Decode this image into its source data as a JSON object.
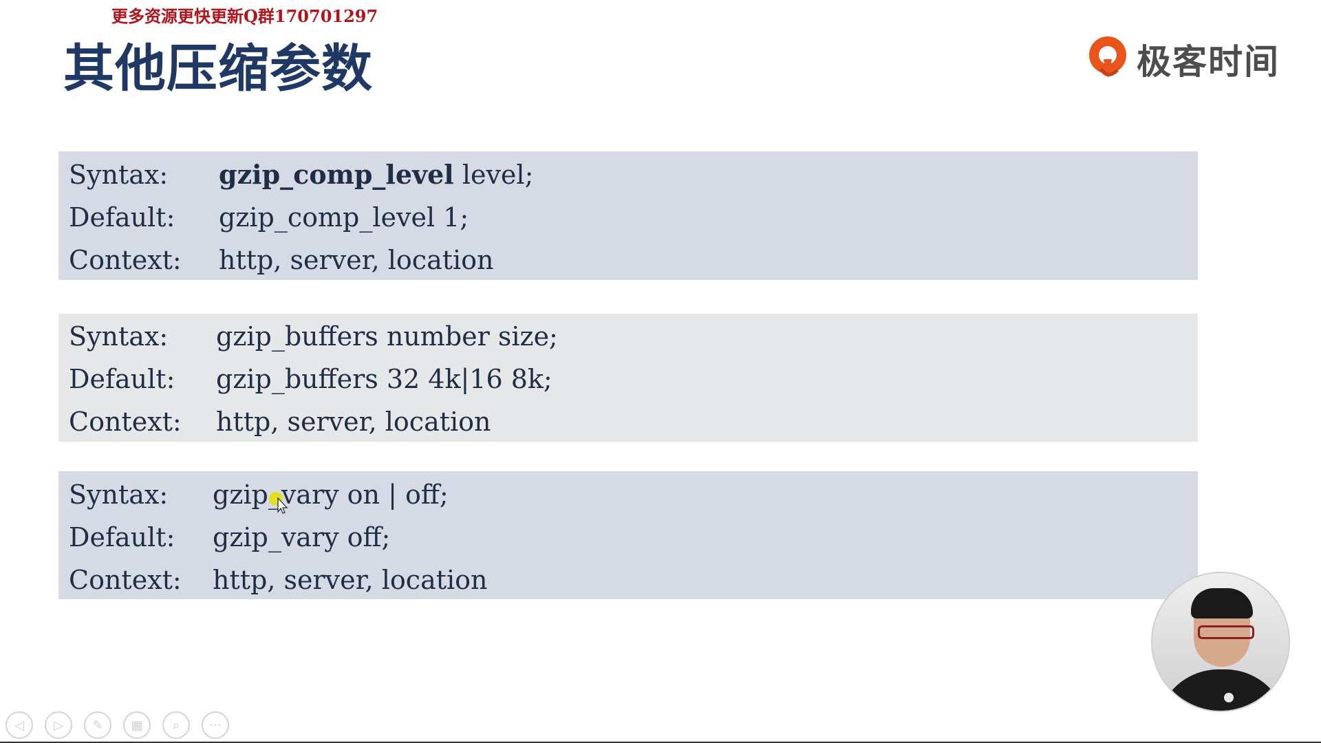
{
  "watermark": "更多资源更快更新Q群170701297",
  "slide": {
    "title": "其他压缩参数"
  },
  "logo": {
    "text": "极客时间",
    "accent_color": "#e8541a"
  },
  "blocks": [
    {
      "rows": [
        {
          "key": "Syntax:",
          "value_bold": "gzip_comp_level",
          "value_rest": " level;"
        },
        {
          "key": "Default:",
          "value": "gzip_comp_level 1;"
        },
        {
          "key": "Context:",
          "value": "http, server, location"
        }
      ]
    },
    {
      "rows": [
        {
          "key": "Syntax:",
          "value": "gzip_buffers number size;"
        },
        {
          "key": "Default:",
          "value": "gzip_buffers 32 4k|16 8k;"
        },
        {
          "key": "Context:",
          "value": "http, server, location"
        }
      ]
    },
    {
      "rows": [
        {
          "key": "Syntax:",
          "value": "gzip_vary on | off;"
        },
        {
          "key": "Default:",
          "value": "gzip_vary off;"
        },
        {
          "key": "Context:",
          "value": "http, server, location"
        }
      ]
    }
  ],
  "toolbar": {
    "icons": [
      "prev-icon",
      "next-icon",
      "pen-icon",
      "slides-icon",
      "zoom-icon",
      "more-icon"
    ],
    "glyphs": [
      "◁",
      "▷",
      "✎",
      "▦",
      "⌕",
      "···"
    ]
  },
  "colors": {
    "title": "#1f3864",
    "block_blue": "#d5dae4",
    "block_gray": "#e6e7e8"
  }
}
